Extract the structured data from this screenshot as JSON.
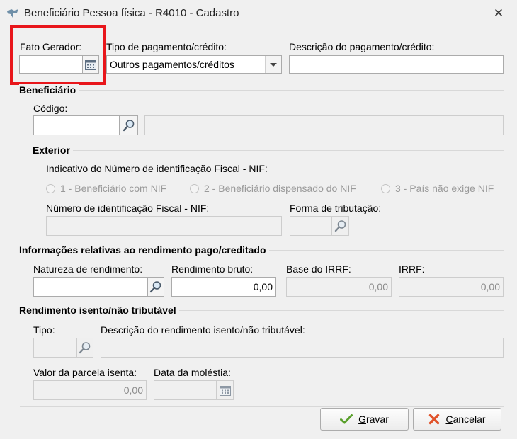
{
  "window": {
    "title": "Beneficiário Pessoa física - R4010 - Cadastro",
    "close_glyph": "✕"
  },
  "top": {
    "fato_gerador_label": "Fato Gerador:",
    "fato_gerador_value": "",
    "tipo_label": "Tipo de pagamento/crédito:",
    "tipo_value": "Outros pagamentos/créditos",
    "descricao_label": "Descrição do pagamento/crédito:",
    "descricao_value": ""
  },
  "beneficiario": {
    "section": "Beneficiário",
    "codigo_label": "Código:",
    "codigo_value": "",
    "nome_value": ""
  },
  "exterior": {
    "section": "Exterior",
    "nif_indicator_label": "Indicativo do Número de identificação Fiscal - NIF:",
    "radios": [
      {
        "label": "1 - Beneficiário com NIF"
      },
      {
        "label": "2 - Beneficiário dispensado do NIF"
      },
      {
        "label": "3 - País não exige NIF"
      }
    ],
    "nif_label": "Número de identificação Fiscal - NIF:",
    "forma_label": "Forma de tributação:"
  },
  "rendimento": {
    "section": "Informações relativas ao rendimento pago/creditado",
    "natureza_label": "Natureza de rendimento:",
    "bruto_label": "Rendimento bruto:",
    "bruto_value": "0,00",
    "base_irrf_label": "Base do IRRF:",
    "base_irrf_value": "0,00",
    "irrf_label": "IRRF:",
    "irrf_value": "0,00"
  },
  "isento": {
    "section": "Rendimento isento/não tributável",
    "tipo_label": "Tipo:",
    "descricao_label": "Descrição do rendimento isento/não tributável:",
    "parcela_label": "Valor da parcela isenta:",
    "parcela_value": "0,00",
    "molestia_label": "Data da moléstia:"
  },
  "buttons": {
    "gravar_pre": "",
    "gravar_key": "G",
    "gravar_rest": "ravar",
    "cancelar_key": "C",
    "cancelar_rest": "ancelar"
  },
  "colors": {
    "highlight": "#e8161b",
    "accent_check": "#5aa02c",
    "accent_cancel": "#e0532b"
  },
  "icons": [
    "app-icon",
    "close-icon",
    "calendar-icon",
    "dropdown-arrow-icon",
    "search-icon",
    "check-icon",
    "cancel-icon"
  ]
}
